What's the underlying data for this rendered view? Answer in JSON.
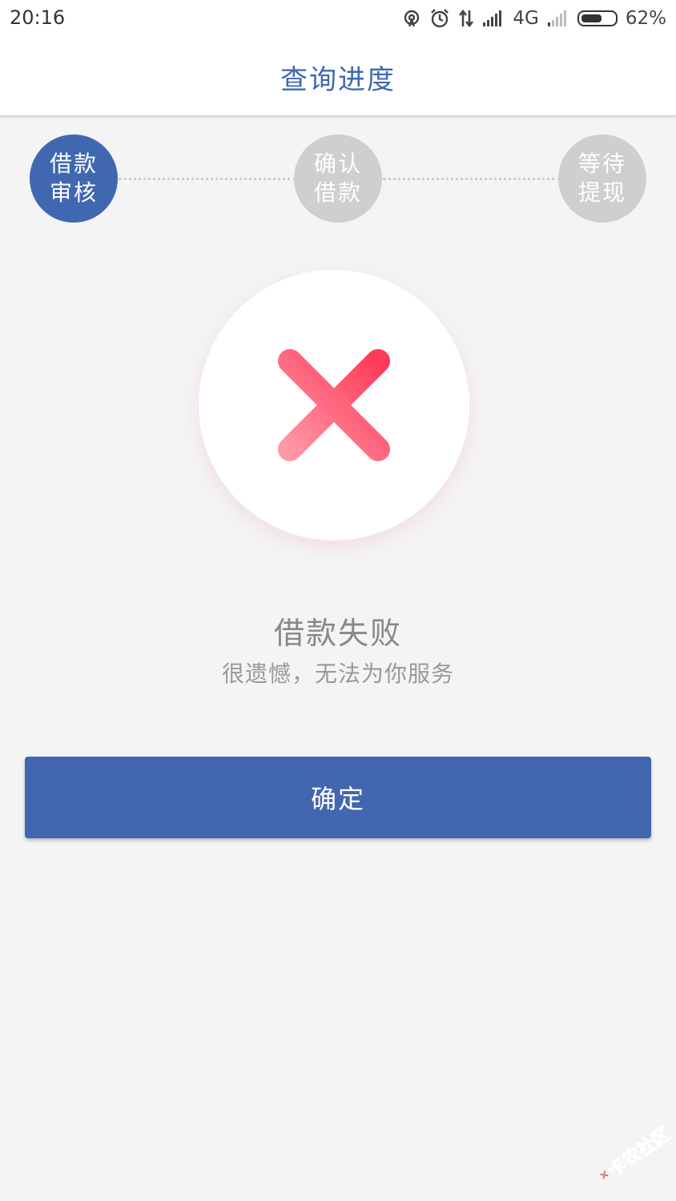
{
  "status_bar": {
    "time": "20:16",
    "network": "4G",
    "battery": "62%",
    "battery_level": 0.62,
    "icons": [
      "hotspot-icon",
      "alarm-icon",
      "data-transfer-icon",
      "signal-icon",
      "signal-weak-icon",
      "battery-icon"
    ]
  },
  "header": {
    "title": "查询进度"
  },
  "steps": [
    {
      "line1": "借款",
      "line2": "审核",
      "state": "active"
    },
    {
      "line1": "确认",
      "line2": "借款",
      "state": "inactive"
    },
    {
      "line1": "等待",
      "line2": "提现",
      "state": "inactive"
    }
  ],
  "result": {
    "icon": "close-x-icon",
    "title": "借款失败",
    "subtitle": "很遗憾，无法为你服务"
  },
  "confirm_button": {
    "label": "确定"
  },
  "watermark": {
    "text": "卡农社区"
  },
  "colors": {
    "primary": "#4267b0",
    "step_inactive": "#cfcfcf",
    "fail_red": "#ff3b5c",
    "background": "#f4f4f4"
  }
}
